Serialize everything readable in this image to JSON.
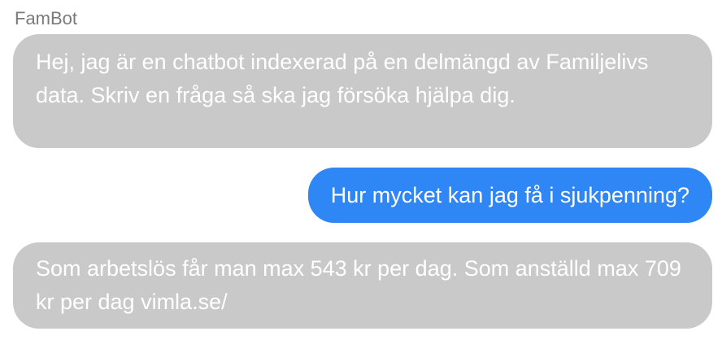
{
  "chat": {
    "bot_name": "FamBot",
    "messages": [
      {
        "role": "bot",
        "text": "Hej, jag är en chatbot indexerad på en delmängd av Familjelivs data. Skriv en fråga så ska jag försöka hjälpa dig."
      },
      {
        "role": "user",
        "text": "Hur mycket kan jag få i sjukpenning?"
      },
      {
        "role": "bot",
        "text": "Som arbetslös får man max 543 kr per dag. Som anställd max 709 kr per dag vimla.se/"
      }
    ]
  },
  "colors": {
    "bot_bubble": "#c9c9c9",
    "user_bubble": "#2f86f5",
    "bubble_text": "#ffffff",
    "name_text": "#7a7a7a"
  }
}
